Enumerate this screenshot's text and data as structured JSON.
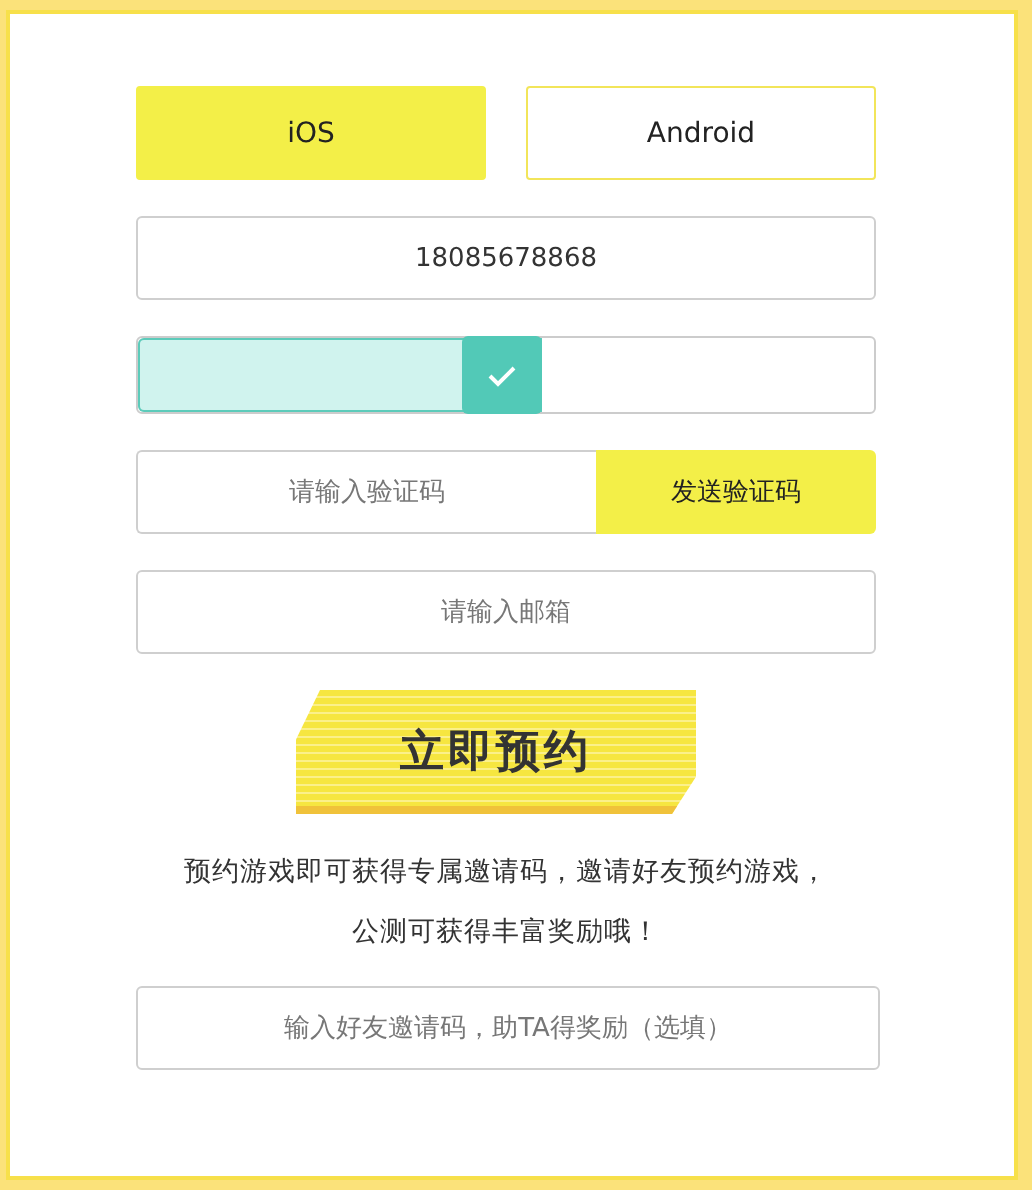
{
  "platform_tabs": [
    {
      "label": "iOS",
      "selected": true
    },
    {
      "label": "Android",
      "selected": false
    }
  ],
  "phone_field": {
    "value": "18085678868"
  },
  "verify_slider": {
    "level": 0.55,
    "verified": true
  },
  "code_field": {
    "placeholder": "请输入验证码"
  },
  "send_code_button": "发送验证码",
  "email_field": {
    "placeholder": "请输入邮箱"
  },
  "reserve_button": "立即预约",
  "info_lines": [
    "预约游戏即可获得专属邀请码，邀请好友预约游戏，",
    "公测可获得丰富奖励哦！"
  ],
  "invite_field": {
    "placeholder": "输入好友邀请码，助TA得奖励（选填）"
  }
}
